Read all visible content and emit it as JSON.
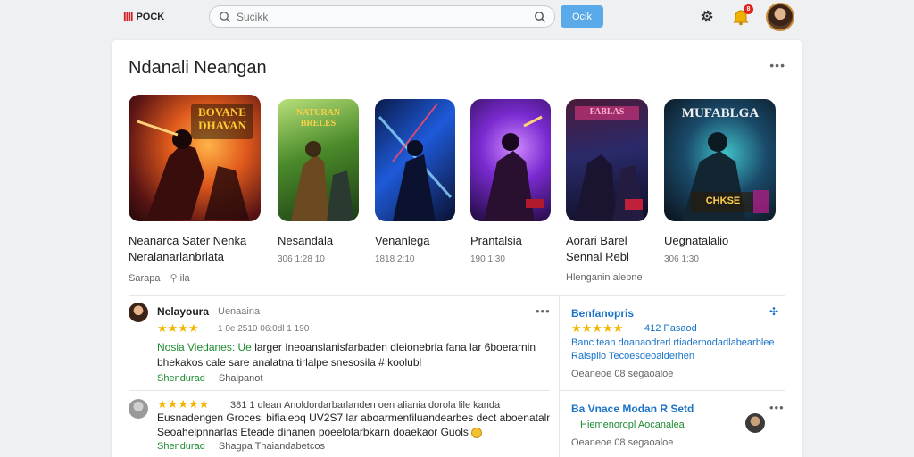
{
  "header": {
    "logo_mark": "ІІІІ",
    "logo_word": "POCK",
    "search_placeholder": "Sucikk",
    "search_button": "Ocik",
    "notification_count": "8",
    "colors": {
      "accent": "#5aa9e8",
      "logo": "#d8202a",
      "badge": "#e2231a"
    }
  },
  "section": {
    "title": "Ndanali Neangan",
    "more": "•••"
  },
  "games": [
    {
      "title_art": "BOVANE DHAVAN",
      "label_1": "Neanarca Sater Nenka",
      "label_2": "Neralanarlanbrlata",
      "meta": "",
      "sub": "Sarapa",
      "sub_icon": "pin-icon",
      "sub_extra": "ila"
    },
    {
      "title_art": "NATURAN BRELES",
      "label_1": "Nesandala",
      "label_2": "",
      "meta": "306 1:28 10",
      "sub": "",
      "sub_extra": ""
    },
    {
      "title_art": "",
      "label_1": "Venanlega",
      "label_2": "",
      "meta": "1818 2:10",
      "sub": "",
      "sub_extra": ""
    },
    {
      "title_art": "",
      "label_1": "Prantalsia",
      "label_2": "",
      "meta": "190 1:30",
      "sub": "",
      "sub_extra": ""
    },
    {
      "title_art": "FABLAS",
      "label_1": "Aorari Barel",
      "label_2": "Sennal Rebl",
      "meta": "",
      "sub": "Hlenganin alepne",
      "sub_extra": ""
    },
    {
      "title_art": "MUFABLGA",
      "label_1": "Uegnatalalio",
      "label_2": "",
      "meta": "306 1:30",
      "sub": "",
      "sub_extra": "",
      "badge_art": "CHKSE"
    }
  ],
  "reviews": [
    {
      "name": "Nelayoura",
      "type": "Uenaaina",
      "stars": "★★★★",
      "date": "1 0e 2510 06:0dl 1 190",
      "text_green": "Nosia Viedanes: Ue",
      "text_1": "larger Ineoanslanisfarbaden dleionebrla fana lar 6boerarnin",
      "text_2": "bhekakos cale sare analatna tirlalpe snesosila # koolubl",
      "foot_green": "Shendurad",
      "foot": "Shalpanot"
    },
    {
      "name": "",
      "type": "",
      "stars": "★★★★★",
      "date": "381 1 dlean Anoldordarbarlanden oen aliania dorola lile kanda",
      "text_green": "",
      "text_1": "Eusnadengen Grocesi bifialeoq UV2S7 lar aboarmenfiluandearbes dect aboenatalnat",
      "text_2": "Seoahelpnnarlas Eteade dinanen poeelotarbkarn doaekaor Guols",
      "foot_green": "Shendurad",
      "foot": "Shagpa   Thaiandabetcos"
    }
  ],
  "side": [
    {
      "title": "Benfanopris",
      "stars": "★★★★★",
      "date": "412 Pasaod",
      "text_1": "Banc tean doanaodrerl rtiadernodadlabearblee",
      "text_2": "Ralsplio Tecoesdeoalderhen",
      "meta": "Oeaneoe 08 segaoaloe"
    },
    {
      "title": "Ba Vnace Modan R Setd",
      "text_green": "Hiemenoropl Aocanalea",
      "meta": "Oeaneoe 08 segaoaloe"
    }
  ]
}
